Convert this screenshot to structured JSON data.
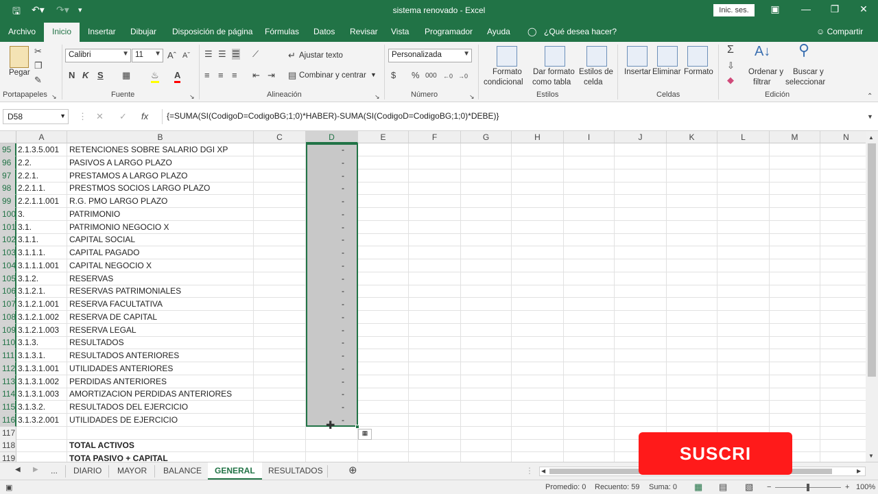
{
  "window": {
    "title": "sistema renovado  -  Excel",
    "signin_label": "Inic. ses.",
    "qat_icons": [
      "save-icon",
      "undo-icon",
      "redo-icon",
      "customize-icon"
    ]
  },
  "menu": {
    "tabs": [
      "Archivo",
      "Inicio",
      "Insertar",
      "Dibujar",
      "Disposición de página",
      "Fórmulas",
      "Datos",
      "Revisar",
      "Vista",
      "Programador",
      "Ayuda"
    ],
    "active": "Inicio",
    "tell_me": "¿Qué desea hacer?",
    "share": "Compartir"
  },
  "ribbon": {
    "clipboard": {
      "paste": "Pegar",
      "group": "Portapapeles"
    },
    "font": {
      "name": "Calibri",
      "size": "11",
      "bold": "N",
      "italic": "K",
      "underline": "S",
      "group": "Fuente"
    },
    "alignment": {
      "wrap": "Ajustar texto",
      "merge": "Combinar y centrar",
      "group": "Alineación"
    },
    "number": {
      "format": "Personalizada",
      "group": "Número"
    },
    "styles": {
      "conditional_1": "Formato",
      "conditional_2": "condicional",
      "table_1": "Dar formato",
      "table_2": "como tabla",
      "cell_1": "Estilos de",
      "cell_2": "celda",
      "group": "Estilos"
    },
    "cells": {
      "insert": "Insertar",
      "delete": "Eliminar",
      "format": "Formato",
      "group": "Celdas"
    },
    "editing": {
      "sort_1": "Ordenar y",
      "sort_2": "filtrar",
      "find_1": "Buscar y",
      "find_2": "seleccionar",
      "group": "Edición"
    }
  },
  "formula_bar": {
    "name_box": "D58",
    "formula": "{=SUMA(SI(CodigoD=CodigoBG;1;0)*HABER)-SUMA(SI(CodigoD=CodigoBG;1;0)*DEBE)}"
  },
  "columns": [
    "A",
    "B",
    "C",
    "D",
    "E",
    "F",
    "G",
    "H",
    "I",
    "J",
    "K",
    "L",
    "M",
    "N"
  ],
  "selected_column": "D",
  "rows": [
    {
      "num": "95",
      "a": "2.1.3.5.001",
      "b": "RETENCIONES SOBRE SALARIO DGI  XP",
      "d": "-"
    },
    {
      "num": "96",
      "a": "2.2.",
      "b": "PASIVOS A LARGO PLAZO",
      "d": "-"
    },
    {
      "num": "97",
      "a": "2.2.1.",
      "b": "PRESTAMOS A LARGO PLAZO",
      "d": "-"
    },
    {
      "num": "98",
      "a": "2.2.1.1.",
      "b": "PRESTMOS SOCIOS LARGO PLAZO",
      "d": "-"
    },
    {
      "num": "99",
      "a": "2.2.1.1.001",
      "b": "R.G. PMO LARGO PLAZO",
      "d": "-"
    },
    {
      "num": "100",
      "a": "3.",
      "b": "PATRIMONIO",
      "d": "-"
    },
    {
      "num": "101",
      "a": "3.1.",
      "b": "PATRIMONIO NEGOCIO X",
      "d": "-"
    },
    {
      "num": "102",
      "a": "3.1.1.",
      "b": "CAPITAL SOCIAL",
      "d": "-"
    },
    {
      "num": "103",
      "a": "3.1.1.1.",
      "b": "CAPITAL PAGADO",
      "d": "-"
    },
    {
      "num": "104",
      "a": "3.1.1.1.001",
      "b": "CAPITAL NEGOCIO X",
      "d": "-"
    },
    {
      "num": "105",
      "a": "3.1.2.",
      "b": "RESERVAS",
      "d": "-"
    },
    {
      "num": "106",
      "a": "3.1.2.1.",
      "b": "RESERVAS PATRIMONIALES",
      "d": "-"
    },
    {
      "num": "107",
      "a": "3.1.2.1.001",
      "b": "RESERVA FACULTATIVA",
      "d": "-"
    },
    {
      "num": "108",
      "a": "3.1.2.1.002",
      "b": "RESERVA DE CAPITAL",
      "d": "-"
    },
    {
      "num": "109",
      "a": "3.1.2.1.003",
      "b": "RESERVA LEGAL",
      "d": "-"
    },
    {
      "num": "110",
      "a": "3.1.3.",
      "b": "RESULTADOS",
      "d": "-"
    },
    {
      "num": "111",
      "a": "3.1.3.1.",
      "b": "RESULTADOS ANTERIORES",
      "d": "-"
    },
    {
      "num": "112",
      "a": "3.1.3.1.001",
      "b": "UTILIDADES ANTERIORES",
      "d": "-"
    },
    {
      "num": "113",
      "a": "3.1.3.1.002",
      "b": "PERDIDAS ANTERIORES",
      "d": "-"
    },
    {
      "num": "114",
      "a": "3.1.3.1.003",
      "b": "AMORTIZACION PERDIDAS ANTERIORES",
      "d": "-"
    },
    {
      "num": "115",
      "a": "3.1.3.2.",
      "b": "RESULTADOS DEL EJERCICIO",
      "d": "-"
    },
    {
      "num": "116",
      "a": "3.1.3.2.001",
      "b": "UTILIDADES DE EJERCICIO",
      "d": "-"
    },
    {
      "num": "117",
      "a": "",
      "b": "",
      "d": ""
    },
    {
      "num": "118",
      "a": "",
      "b": "TOTAL ACTIVOS",
      "d": ""
    },
    {
      "num": "119",
      "a": "",
      "b": "TOTA PASIVO + CAPITAL",
      "d": ""
    }
  ],
  "sheet_tabs": {
    "more": "...",
    "tabs": [
      "DIARIO",
      "MAYOR",
      "BALANCE",
      "GENERAL",
      "RESULTADOS"
    ],
    "active": "GENERAL"
  },
  "status": {
    "average": "Promedio: 0",
    "count": "Recuento: 59",
    "sum": "Suma: 0",
    "zoom": "100%"
  },
  "overlay": {
    "banner_text": "SUSCRI"
  }
}
